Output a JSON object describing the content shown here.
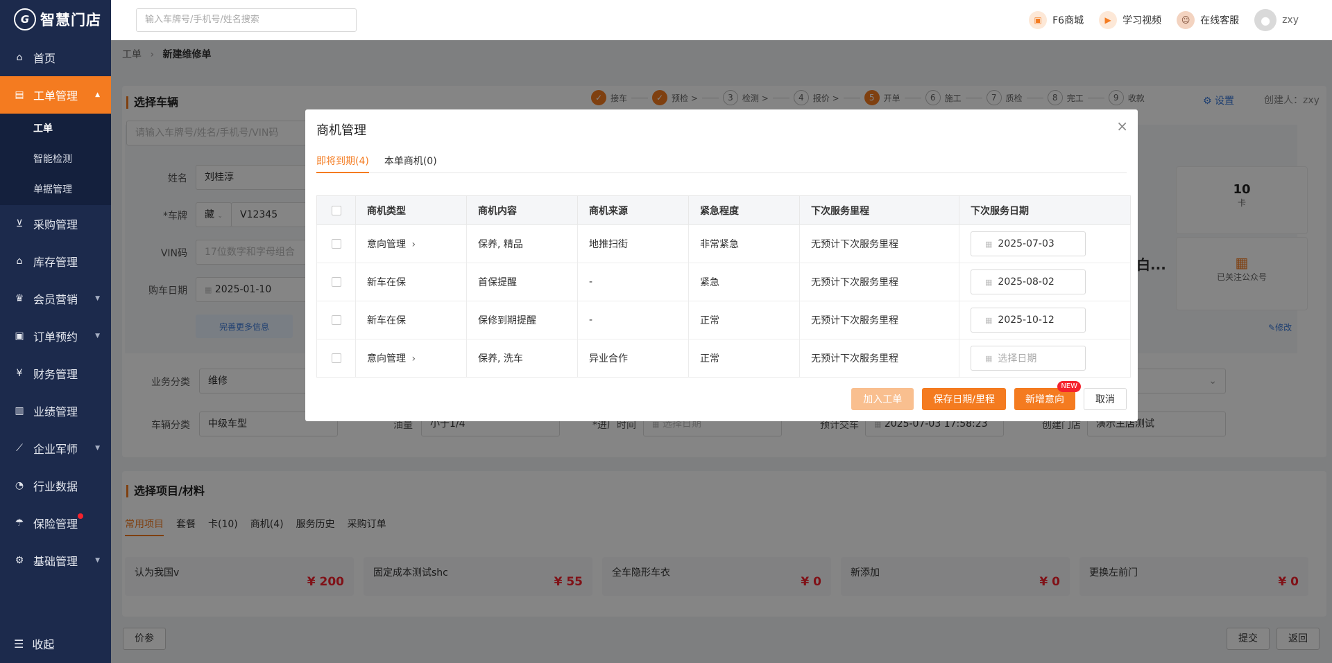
{
  "app": {
    "logo_mark": "G",
    "logo_text": "智慧门店"
  },
  "sidebar": {
    "items": [
      {
        "label": "首页",
        "icon": "home-icon"
      },
      {
        "label": "工单管理",
        "icon": "document-icon",
        "active": true
      },
      {
        "label": "采购管理",
        "icon": "cart-icon"
      },
      {
        "label": "库存管理",
        "icon": "warehouse-icon"
      },
      {
        "label": "会员营销",
        "icon": "crown-icon"
      },
      {
        "label": "订单预约",
        "icon": "clipboard-icon"
      },
      {
        "label": "财务管理",
        "icon": "yen-icon"
      },
      {
        "label": "业绩管理",
        "icon": "bar-chart-icon"
      },
      {
        "label": "企业军师",
        "icon": "trend-icon"
      },
      {
        "label": "行业数据",
        "icon": "gauge-icon"
      },
      {
        "label": "保险管理",
        "icon": "umbrella-icon"
      },
      {
        "label": "基础管理",
        "icon": "gear-icon"
      }
    ],
    "sub_items": [
      "工单",
      "智能检测",
      "单据管理"
    ],
    "collapse_label": "收起"
  },
  "topbar": {
    "search_placeholder": "输入车牌号/手机号/姓名搜索",
    "mall": "F6商城",
    "video": "学习视频",
    "service": "在线客服",
    "user": "zxy"
  },
  "breadcrumb": {
    "root": "工单",
    "current": "新建维修单"
  },
  "page": {
    "section_vehicle": "选择车辆",
    "vehicle_search_placeholder": "请输入车牌号/姓名/手机号/VIN码",
    "steps": [
      {
        "num": "",
        "label": "接车",
        "done": true
      },
      {
        "num": "",
        "label": "预检 >",
        "done": true
      },
      {
        "num": "3",
        "label": "检测 >"
      },
      {
        "num": "4",
        "label": "报价 >"
      },
      {
        "num": "5",
        "label": "开单",
        "done": true
      },
      {
        "num": "6",
        "label": "施工"
      },
      {
        "num": "7",
        "label": "质检"
      },
      {
        "num": "8",
        "label": "完工"
      },
      {
        "num": "9",
        "label": "收款"
      }
    ],
    "settings": "设置",
    "creator": "创建人：zxy",
    "name_label": "姓名",
    "name_value": "刘桂淳",
    "plate_label": "*车牌",
    "plate_prefix": "藏",
    "plate_value": "V12345",
    "vin_label": "VIN码",
    "vin_placeholder": "17位数字和字母组合",
    "buy_date_label": "购车日期",
    "buy_date_value": "2025-01-10",
    "more_info": "完善更多信息",
    "stat_count": "10",
    "stat_unit": "卡",
    "stat_white": "白...",
    "wechat": "已关注公众号",
    "modify": "修改",
    "biz_label": "业务分类",
    "biz_value": "维修",
    "car_class_label": "车辆分类",
    "car_class_value": "中级车型",
    "oil_label": "油量",
    "oil_value": "小于1/4",
    "in_time_label": "*进厂时间",
    "in_time_placeholder": "选择日期",
    "deliver_label": "预计交车",
    "deliver_value": "2025-07-03 17:58:23",
    "store_label": "创建门店",
    "store_value": "演示主店测试",
    "section_items": "选择项目/材料",
    "tabs": [
      "常用项目",
      "套餐",
      "卡(10)",
      "商机(4)",
      "服务历史",
      "采购订单"
    ],
    "items": [
      {
        "name": "认为我国v",
        "price": "¥ 200"
      },
      {
        "name": "固定成本测试shc",
        "price": "¥ 55"
      },
      {
        "name": "全车隐形车衣",
        "price": "¥ 0"
      },
      {
        "name": "新添加",
        "price": "¥ 0"
      },
      {
        "name": "更换左前门",
        "price": "¥ 0"
      }
    ],
    "price_ref": "价参",
    "submit": "提交",
    "back": "返回"
  },
  "modal": {
    "title": "商机管理",
    "tabs": [
      "即将到期(4)",
      "本单商机(0)"
    ],
    "columns": [
      "商机类型",
      "商机内容",
      "商机来源",
      "紧急程度",
      "下次服务里程",
      "下次服务日期"
    ],
    "rows": [
      {
        "type": "意向管理",
        "arrow": true,
        "content": "保养, 精品",
        "source": "地推扫街",
        "urgency": "非常紧急",
        "level": "red",
        "mileage": "无预计下次服务里程",
        "date": "2025-07-03"
      },
      {
        "type": "新车在保",
        "arrow": false,
        "content": "首保提醒",
        "source": "-",
        "urgency": "紧急",
        "level": "orange",
        "mileage": "无预计下次服务里程",
        "date": "2025-08-02"
      },
      {
        "type": "新车在保",
        "arrow": false,
        "content": "保修到期提醒",
        "source": "-",
        "urgency": "正常",
        "level": "normal",
        "mileage": "无预计下次服务里程",
        "date": "2025-10-12"
      },
      {
        "type": "意向管理",
        "arrow": true,
        "content": "保养, 洗车",
        "source": "异业合作",
        "urgency": "正常",
        "level": "normal",
        "mileage": "无预计下次服务里程",
        "date": ""
      }
    ],
    "date_placeholder": "选择日期",
    "btn_add": "加入工单",
    "btn_save": "保存日期/里程",
    "btn_new": "新增意向",
    "new_badge": "NEW",
    "btn_cancel": "取消"
  },
  "colors": {
    "accent": "#f47b20",
    "sidebar": "#1c2a4c",
    "danger": "#f5222d",
    "warning": "#fa8c16"
  }
}
